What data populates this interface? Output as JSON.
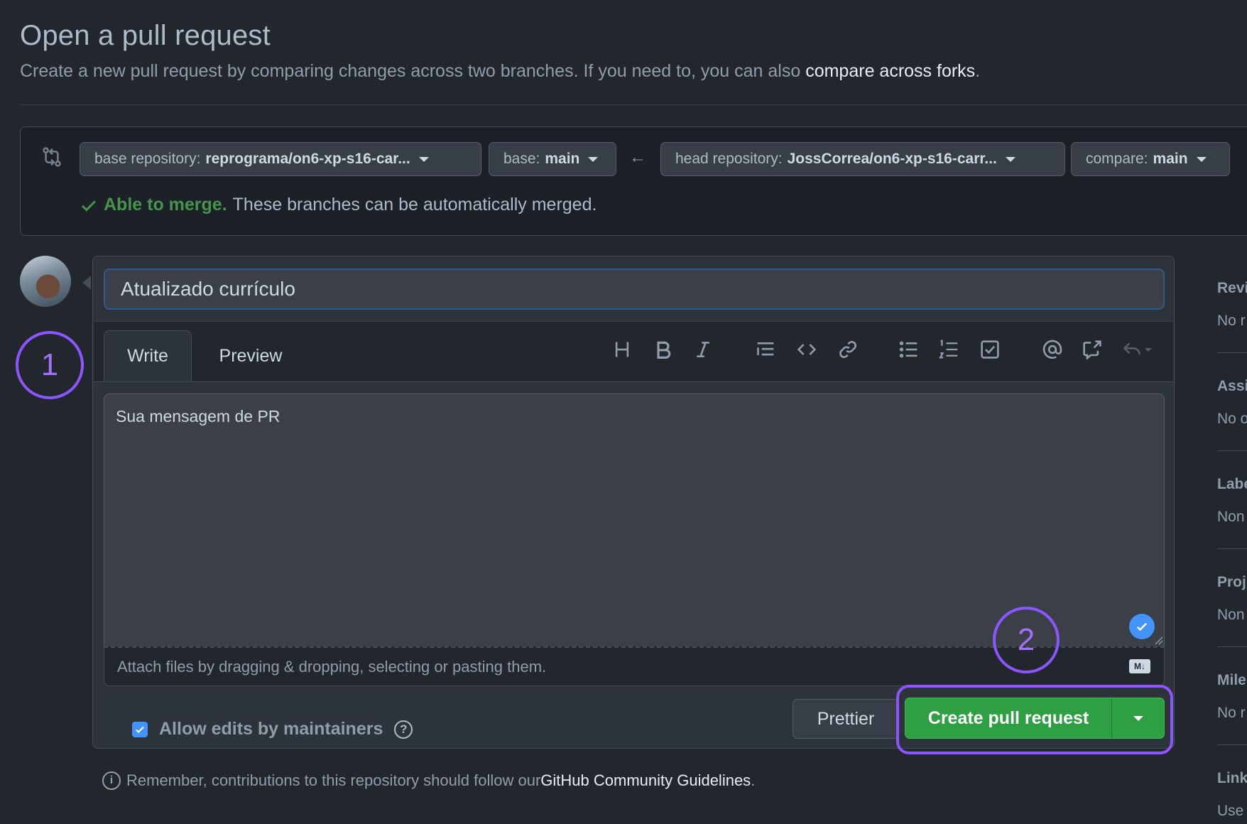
{
  "page": {
    "title": "Open a pull request",
    "subtitle": "Create a new pull request by comparing changes across two branches. If you need to, you can also ",
    "subtitle_link": "compare across forks",
    "subtitle_end": "."
  },
  "compare": {
    "base_repo_label": "base repository:",
    "base_repo_value": "reprograma/on6-xp-s16-car...",
    "base_label": "base:",
    "base_value": "main",
    "head_repo_label": "head repository:",
    "head_repo_value": "JossCorrea/on6-xp-s16-carr...",
    "compare_label": "compare:",
    "compare_value": "main",
    "merge_ok": "Able to merge.",
    "merge_text": "These branches can be automatically merged.",
    "icons": {
      "compare": "git-compare-icon",
      "arrow": "arrow-left-icon",
      "check": "check-icon"
    }
  },
  "form": {
    "title_value": "Atualizado currículo",
    "tabs": [
      "Write",
      "Preview"
    ],
    "body_value": "Sua mensagem de PR",
    "attach_text": "Attach files by dragging & dropping, selecting or pasting them.",
    "md_badge": "M↓",
    "allow_edits": "Allow edits by maintainers",
    "prettier_button": "Prettier",
    "create_button": "Create pull request",
    "toolbar_icons": [
      "heading-icon",
      "bold-icon",
      "italic-icon",
      "quote-icon",
      "code-icon",
      "link-icon",
      "bulleted-list-icon",
      "numbered-list-icon",
      "task-list-icon",
      "mention-icon",
      "cross-reference-icon",
      "reply-icon"
    ]
  },
  "annotations": {
    "step1": "1",
    "step2": "2"
  },
  "footer": {
    "text": "Remember, contributions to this repository should follow our ",
    "link": "GitHub Community Guidelines",
    "end": "."
  },
  "sidebar": {
    "items": [
      {
        "heading": "Revi",
        "value": "No r"
      },
      {
        "heading": "Assi",
        "value": "No o"
      },
      {
        "heading": "Labe",
        "value": "Non"
      },
      {
        "heading": "Proj",
        "value": "Non"
      },
      {
        "heading": "Mile",
        "value": "No r"
      },
      {
        "heading": "Link",
        "value": "Use"
      }
    ]
  },
  "colors": {
    "accent_green": "#2ea043",
    "annotation_purple": "#8c55ff",
    "merge_green": "#46954a",
    "link_blue": "#4493f8"
  }
}
